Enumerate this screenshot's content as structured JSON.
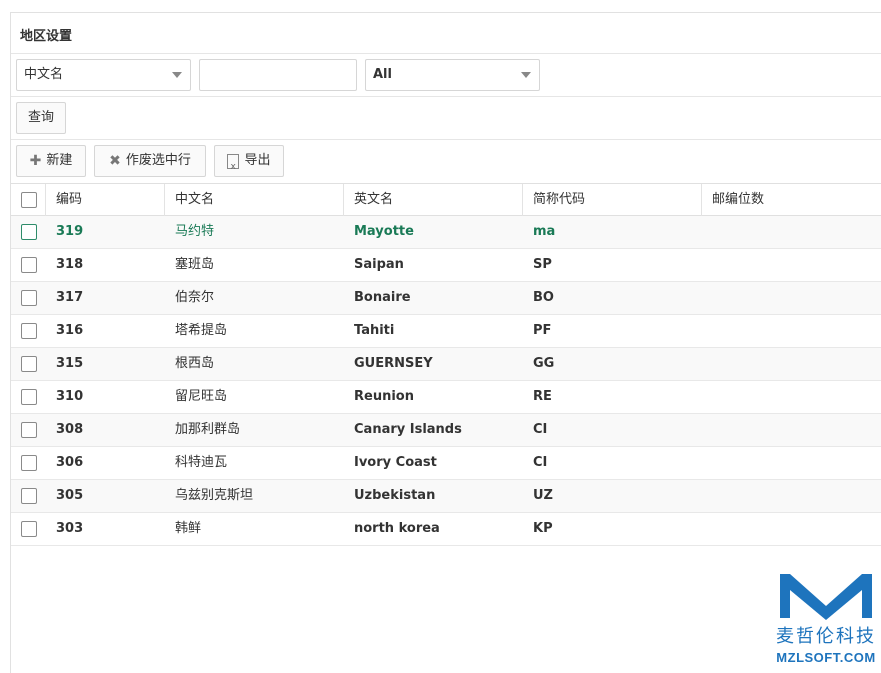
{
  "panel": {
    "title": "地区设置"
  },
  "filters": {
    "field_select": "中文名",
    "search_value": "",
    "status_select": "All",
    "query_label": "查询"
  },
  "toolbar": {
    "new_label": "新建",
    "new_icon": "plus-icon",
    "void_label": "作废选中行",
    "void_icon": "x-icon",
    "export_label": "导出",
    "export_icon": "excel-file-icon"
  },
  "table": {
    "columns": [
      "编码",
      "中文名",
      "英文名",
      "简称代码",
      "邮编位数"
    ],
    "rows": [
      {
        "code": "319",
        "cn": "马约特",
        "en": "Mayotte",
        "abbr": "ma",
        "zip": ""
      },
      {
        "code": "318",
        "cn": "塞班岛",
        "en": "Saipan",
        "abbr": "SP",
        "zip": ""
      },
      {
        "code": "317",
        "cn": "伯奈尔",
        "en": "Bonaire",
        "abbr": "BO",
        "zip": ""
      },
      {
        "code": "316",
        "cn": "塔希提岛",
        "en": "Tahiti",
        "abbr": "PF",
        "zip": ""
      },
      {
        "code": "315",
        "cn": "根西岛",
        "en": "GUERNSEY",
        "abbr": "GG",
        "zip": ""
      },
      {
        "code": "310",
        "cn": "留尼旺岛",
        "en": "Reunion",
        "abbr": "RE",
        "zip": ""
      },
      {
        "code": "308",
        "cn": "加那利群岛",
        "en": "Canary Islands",
        "abbr": "CI",
        "zip": ""
      },
      {
        "code": "306",
        "cn": "科特迪瓦",
        "en": "Ivory Coast",
        "abbr": "CI",
        "zip": ""
      },
      {
        "code": "305",
        "cn": "乌兹别克斯坦",
        "en": "Uzbekistan",
        "abbr": "UZ",
        "zip": ""
      },
      {
        "code": "303",
        "cn": "韩鲜",
        "en": "north korea",
        "abbr": "KP",
        "zip": ""
      }
    ]
  },
  "watermark": {
    "cn": "麦哲伦科技",
    "en": "MZLSOFT.COM",
    "color": "#1e74bd"
  },
  "colors": {
    "selected_text": "#1a7a56"
  }
}
